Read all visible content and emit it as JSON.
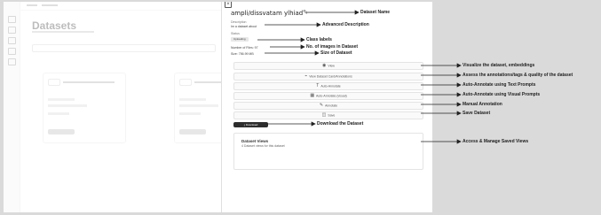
{
  "background": {
    "title": "Datasets",
    "card_title": "amptilidatasetanyglhiad b"
  },
  "drawer": {
    "close_icon": "close-icon",
    "dataset_name": "ampli/dissvatam ylhiad",
    "edit_icon": "pencil-icon",
    "description_label": "Description",
    "description_value": "Im a dataset about",
    "status_label": "Status",
    "status_chip": "Uploading",
    "images_label": "Number of Files: 97",
    "size_label": "Size: 756.99 MB",
    "buttons": {
      "view": "View",
      "view_dataset": "View Dataset Card/Annotations",
      "auto_annotate_text": "Auto-Annotate",
      "auto_annotate_visual": "Auto-Annotate (visual)",
      "annotate": "Annotate",
      "save": "Save"
    },
    "download_label": "Download",
    "views_title": "Dataset Views",
    "views_desc": "4 Dataset views for this dataset"
  },
  "annotations": {
    "dataset_name": "Dataset Name",
    "advanced_description": "Advanced Description",
    "class_labels": "Class labels",
    "num_images": "No. of images in Dataset",
    "size": "Size of Dataset",
    "visualize": "Visualize the dataset, embeddings",
    "assess": "Assess the annotations/tags & quality of the dataset",
    "auto_text": "Auto-Annotate using Text Prompts",
    "auto_visual": "Auto-Annotate using Visual Prompts",
    "manual": "Manual Annotation",
    "save": "Save Dataset",
    "download": "Download the Dataset",
    "views": "Access & Manage Saved Views"
  }
}
